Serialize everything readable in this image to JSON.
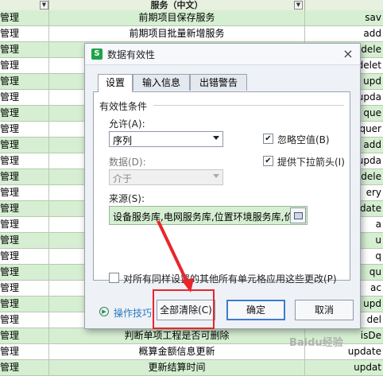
{
  "sheet": {
    "header": {
      "service_col": "服务（中文）"
    },
    "rows": [
      {
        "c1": "管理",
        "c2": "前期项目保存服务",
        "c3": "sav"
      },
      {
        "c1": "管理",
        "c2": "前期项目批量新增服务",
        "c3": "add"
      },
      {
        "c1": "管理",
        "c2": "",
        "c3": "dele"
      },
      {
        "c1": "管理",
        "c2": "",
        "c3": "delet"
      },
      {
        "c1": "管理",
        "c2": "",
        "c3": "upd"
      },
      {
        "c1": "管理",
        "c2": "",
        "c3": "upda"
      },
      {
        "c1": "管理",
        "c2": "",
        "c3": "que"
      },
      {
        "c1": "管理",
        "c2": "",
        "c3": "quer"
      },
      {
        "c1": "管理",
        "c2": "",
        "c3": "add"
      },
      {
        "c1": "管理",
        "c2": "",
        "c3": "upda"
      },
      {
        "c1": "管理",
        "c2": "",
        "c3": "dele"
      },
      {
        "c1": "管理",
        "c2": "",
        "c3": "ery"
      },
      {
        "c1": "管理",
        "c2": "",
        "c3": "date"
      },
      {
        "c1": "管理",
        "c2": "",
        "c3": "a"
      },
      {
        "c1": "管理",
        "c2": "",
        "c3": "u"
      },
      {
        "c1": "管理",
        "c2": "",
        "c3": "q"
      },
      {
        "c1": "管理",
        "c2": "",
        "c3": "qu"
      },
      {
        "c1": "管理",
        "c2": "",
        "c3": "ac"
      },
      {
        "c1": "管理",
        "c2": "",
        "c3": "upd"
      },
      {
        "c1": "管理",
        "c2": "",
        "c3": "del"
      },
      {
        "c1": "管理",
        "c2": "判断单项工程是否可删除",
        "c3": "isDe"
      },
      {
        "c1": "管理",
        "c2": "概算金额信息更新",
        "c3": "update"
      },
      {
        "c1": "管理",
        "c2": "更新结算时间",
        "c3": "updat"
      }
    ]
  },
  "dialog": {
    "title": "数据有效性",
    "close": "×",
    "app_icon": "S",
    "tabs": [
      {
        "label": "设置"
      },
      {
        "label": "输入信息"
      },
      {
        "label": "出错警告"
      }
    ],
    "section_title": "有效性条件",
    "allow_label": "允许(A):",
    "allow_value": "序列",
    "data_label": "数据(D):",
    "data_value": "介于",
    "ignore_blank_label": "忽略空值(B)",
    "ignore_blank_checked": true,
    "dropdown_label": "提供下拉箭头(I)",
    "dropdown_checked": true,
    "source_label": "来源(S):",
    "source_value": "设备服务库,电网服务库,位置环境服务库,价",
    "apply_all_label": "对所有同样设置的其他所有单元格应用这些更改(P)",
    "apply_all_checked": false,
    "tips_label": "操作技巧",
    "clear_all_label": "全部清除(C)",
    "ok_label": "确定",
    "cancel_label": "取消"
  },
  "annotation": {
    "color": "#e8262a"
  },
  "watermark": "Baidu经验",
  "icons": [
    "app-logo-icon",
    "close-icon",
    "dropdown-arrow-icon",
    "checkbox-check-icon",
    "range-select-icon",
    "tips-play-icon",
    "filter-icon"
  ]
}
